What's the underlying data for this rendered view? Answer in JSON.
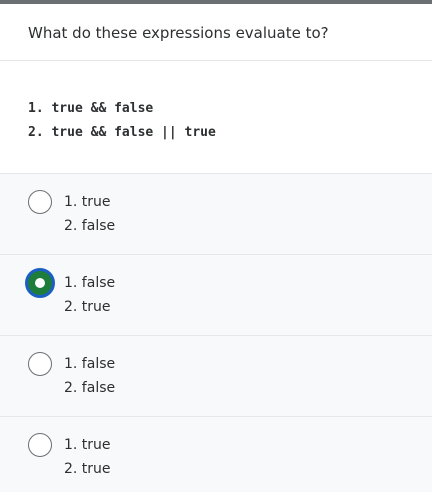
{
  "question": {
    "prompt": "What do these expressions evaluate to?",
    "code_lines": [
      "1. true && false",
      "2. true && false || true"
    ]
  },
  "options": [
    {
      "line1": "1. true",
      "line2": "2. false",
      "selected": false
    },
    {
      "line1": "1. false",
      "line2": "2. true",
      "selected": true
    },
    {
      "line1": "1. false",
      "line2": "2. false",
      "selected": false
    },
    {
      "line1": "1. true",
      "line2": "2. true",
      "selected": false
    }
  ],
  "colors": {
    "selected_fill": "#1e7d3b",
    "selected_ring": "#1c5fc4",
    "option_background": "#f7f9fa",
    "top_bar": "#6a6f73"
  }
}
